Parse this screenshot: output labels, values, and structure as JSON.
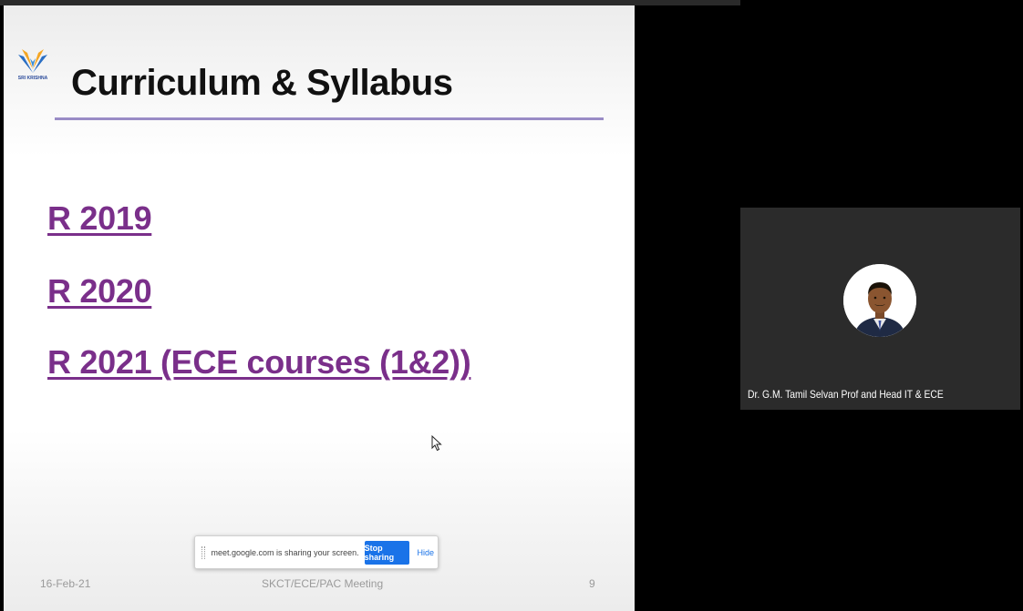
{
  "slide": {
    "title": "Curriculum & Syllabus",
    "logo_text": "SRI KRISHNA",
    "links": [
      {
        "label": "R 2019"
      },
      {
        "label": "R 2020"
      },
      {
        "label": "R 2021 (ECE courses (1&2))"
      }
    ],
    "footer": {
      "date": "16-Feb-21",
      "center": "SKCT/ECE/PAC Meeting",
      "page_number": "9"
    },
    "colors": {
      "link": "#7a2f8a",
      "title_rule": "#9a8cc6"
    }
  },
  "share_bar": {
    "message": "meet.google.com is sharing your screen.",
    "stop_label": "Stop sharing",
    "hide_label": "Hide",
    "accent": "#1a73e8"
  },
  "participant": {
    "name": "Dr. G.M. Tamil Selvan Prof and Head IT & ECE",
    "avatar": "person-avatar"
  }
}
